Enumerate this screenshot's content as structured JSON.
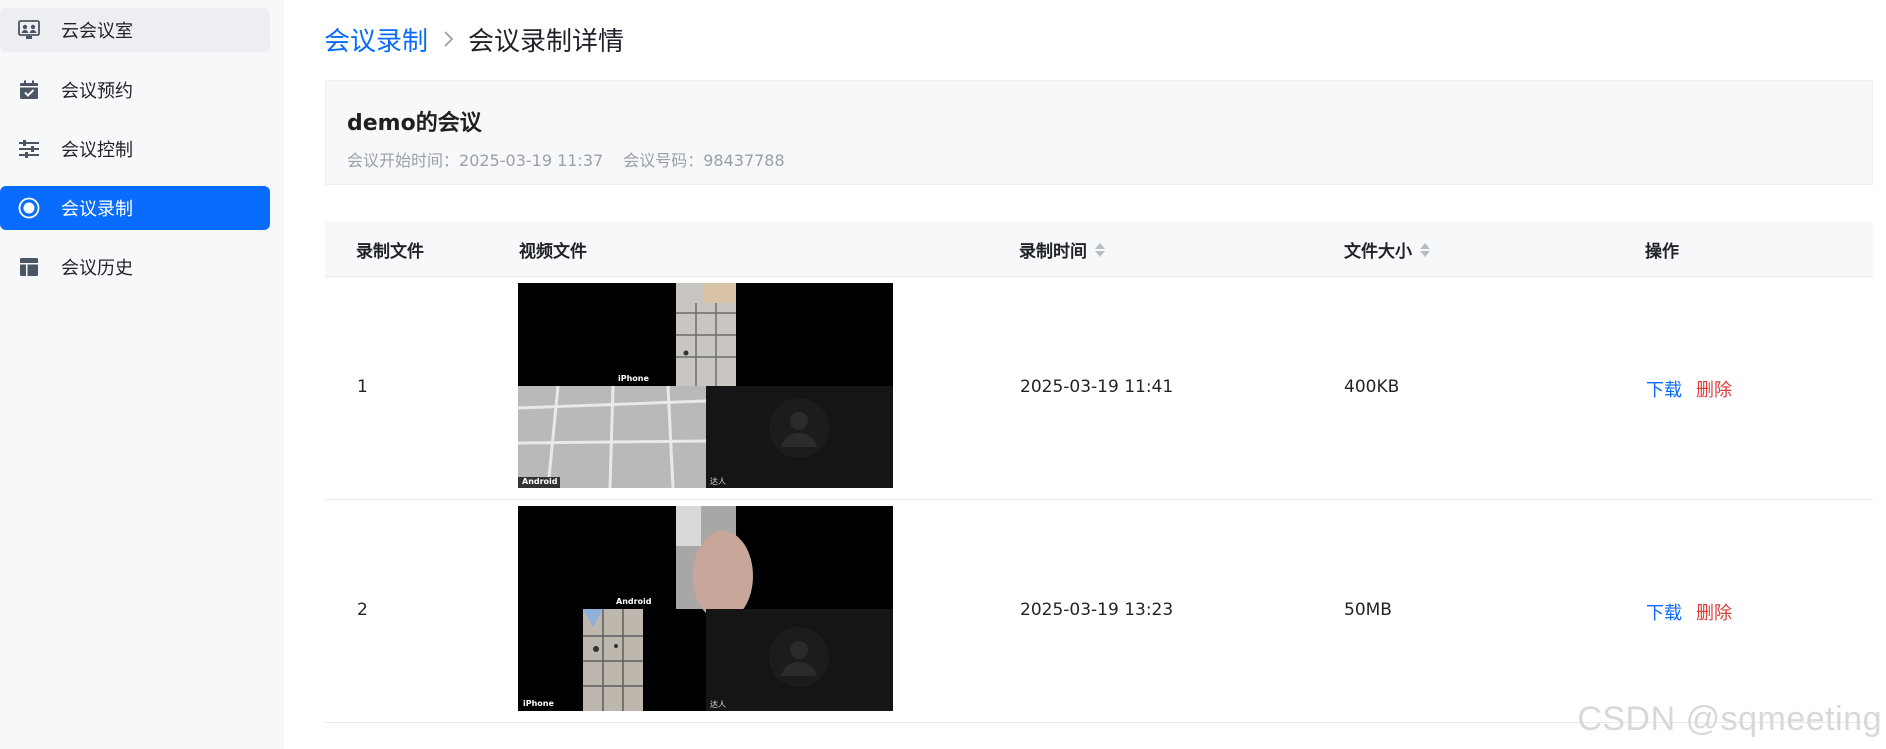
{
  "sidebar": {
    "items": [
      {
        "label": "云会议室",
        "icon": "meeting-room-icon"
      },
      {
        "label": "会议预约",
        "icon": "calendar-check-icon"
      },
      {
        "label": "会议控制",
        "icon": "sliders-icon"
      },
      {
        "label": "会议录制",
        "icon": "record-icon"
      },
      {
        "label": "会议历史",
        "icon": "layout-history-icon"
      }
    ],
    "active": "会议录制",
    "accent_color": "#0a6cff"
  },
  "breadcrumb": {
    "parent": "会议录制",
    "current": "会议录制详情"
  },
  "meeting": {
    "title": "demo的会议",
    "start_time_label": "会议开始时间：",
    "start_time": "2025-03-19 11:37",
    "number_label": "会议号码：",
    "number": "98437788"
  },
  "table": {
    "headers": {
      "file": "录制文件",
      "video": "视频文件",
      "time": "录制时间",
      "size": "文件大小",
      "action": "操作"
    },
    "rows": [
      {
        "index": "1",
        "time": "2025-03-19 11:41",
        "size": "400KB",
        "download": "下载",
        "delete": "删除",
        "thumb_labels": {
          "a": "iPhone",
          "b": "Android",
          "c": "达人"
        }
      },
      {
        "index": "2",
        "time": "2025-03-19 13:23",
        "size": "50MB",
        "download": "下载",
        "delete": "删除",
        "thumb_labels": {
          "a": "Android",
          "b": "iPhone",
          "c": "达人"
        }
      }
    ]
  },
  "watermark": "CSDN @sqmeeting"
}
